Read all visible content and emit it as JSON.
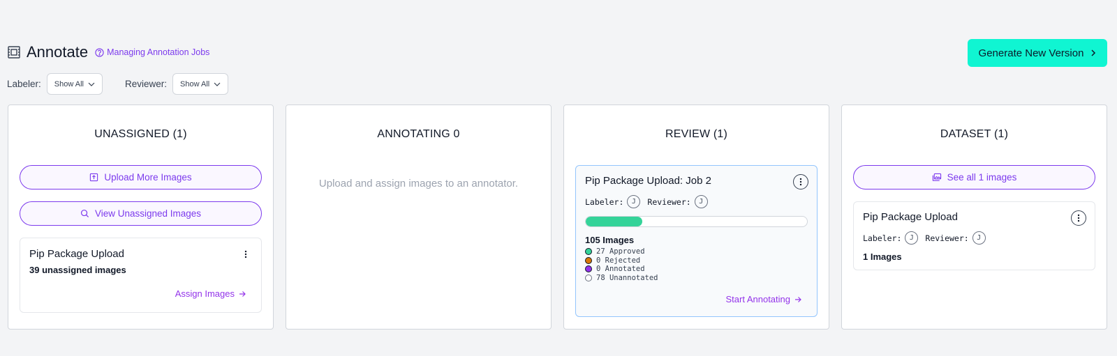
{
  "header": {
    "title": "Annotate",
    "help_link": "Managing Annotation Jobs",
    "generate_button": "Generate New Version"
  },
  "filters": {
    "labeler_label": "Labeler:",
    "labeler_value": "Show All",
    "reviewer_label": "Reviewer:",
    "reviewer_value": "Show All"
  },
  "columns": {
    "unassigned": {
      "title": "UNASSIGNED (1)",
      "upload_button": "Upload More Images",
      "view_button": "View Unassigned Images",
      "card": {
        "title": "Pip Package Upload",
        "count": "39 unassigned images",
        "action": "Assign Images"
      }
    },
    "annotating": {
      "title": "ANNOTATING 0",
      "empty_text": "Upload and assign images to an annotator."
    },
    "review": {
      "title": "REVIEW (1)",
      "card": {
        "title": "Pip Package Upload: Job 2",
        "labeler_label": "Labeler:",
        "labeler_initial": "J",
        "reviewer_label": "Reviewer:",
        "reviewer_initial": "J",
        "progress_percent": 25.7,
        "images_total": "105 Images",
        "stats": [
          {
            "label": "27 Approved",
            "color": "#34d399"
          },
          {
            "label": "0 Rejected",
            "color": "#d97706"
          },
          {
            "label": "0 Annotated",
            "color": "#9333ea"
          },
          {
            "label": "78 Unannotated",
            "color": "#ffffff"
          }
        ],
        "action": "Start Annotating"
      }
    },
    "dataset": {
      "title": "DATASET (1)",
      "see_all_button": "See all 1 images",
      "card": {
        "title": "Pip Package Upload",
        "labeler_label": "Labeler:",
        "labeler_initial": "J",
        "reviewer_label": "Reviewer:",
        "reviewer_initial": "J",
        "count": "1 Images"
      }
    }
  },
  "colors": {
    "accent": "#7c3aed",
    "primary_button": "#10f5d2",
    "progress": "#34d399"
  }
}
